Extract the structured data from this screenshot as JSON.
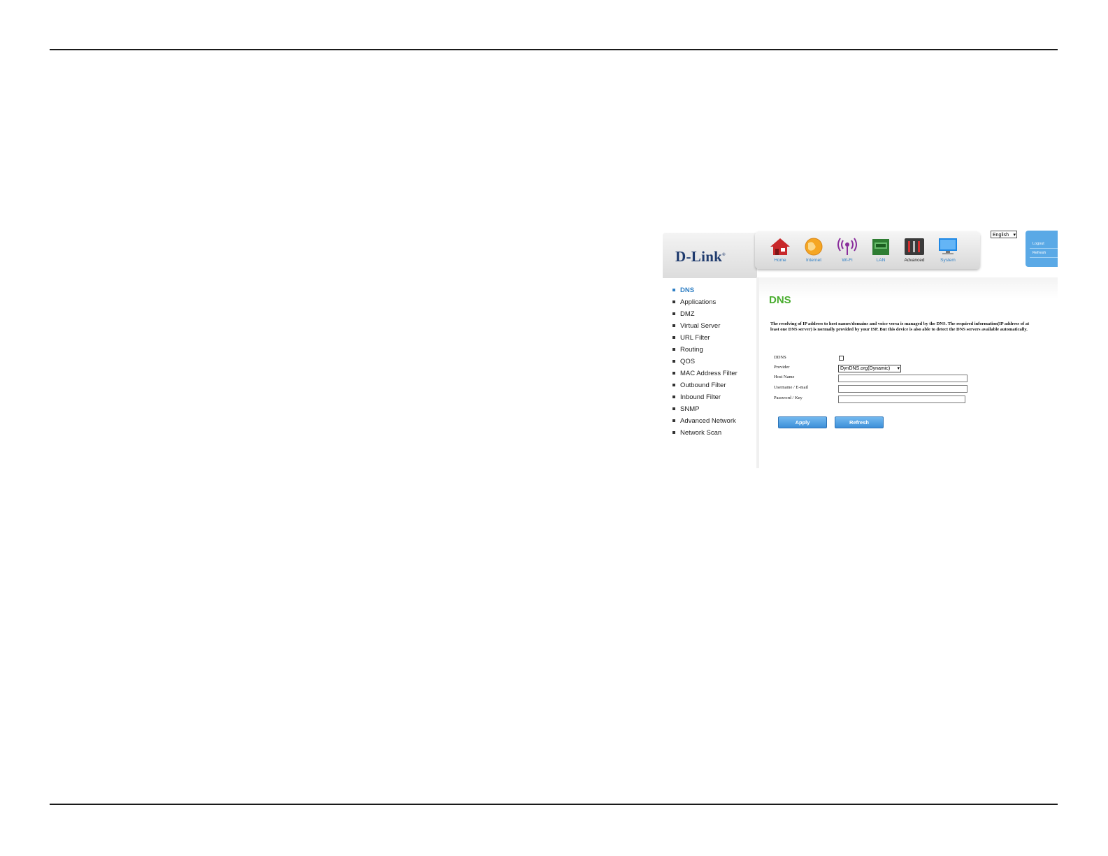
{
  "header": {
    "logo_text": "D-Link",
    "language": "English",
    "side_links": [
      "Logout",
      "Refresh"
    ],
    "nav": [
      {
        "label": "Home",
        "icon": "home-icon"
      },
      {
        "label": "Internet",
        "icon": "globe-icon"
      },
      {
        "label": "Wi-Fi",
        "icon": "wifi-icon"
      },
      {
        "label": "LAN",
        "icon": "lan-icon"
      },
      {
        "label": "Advanced",
        "icon": "tools-icon",
        "active": true
      },
      {
        "label": "System",
        "icon": "monitor-icon"
      }
    ]
  },
  "sidebar": {
    "items": [
      {
        "label": "DNS",
        "active": true
      },
      {
        "label": "Applications"
      },
      {
        "label": "DMZ"
      },
      {
        "label": "Virtual Server"
      },
      {
        "label": "URL Filter"
      },
      {
        "label": "Routing"
      },
      {
        "label": "QOS"
      },
      {
        "label": "MAC Address Filter"
      },
      {
        "label": "Outbound Filter"
      },
      {
        "label": "Inbound Filter"
      },
      {
        "label": "SNMP"
      },
      {
        "label": "Advanced Network"
      },
      {
        "label": "Network Scan"
      }
    ]
  },
  "main": {
    "title": "DNS",
    "description": "The resolving of IP address to host names/domains and voice versa is managed by the DNS. The required information(IP address of at least one DNS server) is normally provided by your ISP. But this device is also able to detect the DNS servers available automatically.",
    "form": {
      "ddns_label": "DDNS",
      "ddns_checked": false,
      "provider_label": "Provider",
      "provider_value": "DynDNS.org(Dynamic)",
      "host_name_label": "Host Name",
      "host_name_value": "",
      "username_label": "Username / E-mail",
      "username_value": "",
      "password_label": "Password / Key",
      "password_value": ""
    },
    "buttons": {
      "apply": "Apply",
      "refresh": "Refresh"
    }
  },
  "colors": {
    "title_green": "#49ad2f",
    "link_blue": "#2f7fc4",
    "button_blue": "#3d8fd8",
    "logo_navy": "#1f3b6e"
  }
}
